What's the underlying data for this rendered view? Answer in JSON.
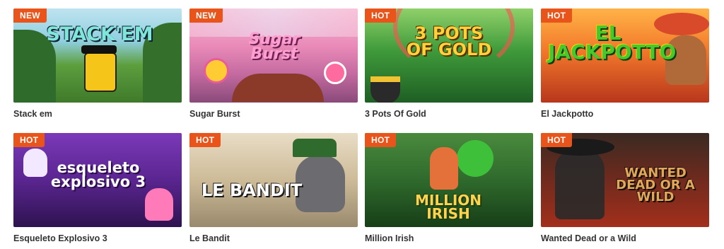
{
  "games": [
    {
      "title": "Stack em",
      "badge": "NEW",
      "logo": "STACK'EM",
      "art": "stack"
    },
    {
      "title": "Sugar Burst",
      "badge": "NEW",
      "logo": "Sugar Burst",
      "art": "sugar"
    },
    {
      "title": "3 Pots Of Gold",
      "badge": "HOT",
      "logo": "3 POTS OF GOLD",
      "art": "pots"
    },
    {
      "title": "El Jackpotto",
      "badge": "HOT",
      "logo": "EL JACKPOTTO",
      "art": "jackpotto"
    },
    {
      "title": "Esqueleto Explosivo 3",
      "badge": "HOT",
      "logo": "esqueleto explosivo 3",
      "art": "esqueleto"
    },
    {
      "title": "Le Bandit",
      "badge": "HOT",
      "logo": "LE BANDIT",
      "art": "bandit"
    },
    {
      "title": "Million Irish",
      "badge": "HOT",
      "logo": "MILLION IRISH",
      "art": "irish"
    },
    {
      "title": "Wanted Dead or a Wild",
      "badge": "HOT",
      "logo": "WANTED DEAD OR A WILD",
      "art": "wanted"
    }
  ],
  "colors": {
    "badge_bg": "#e8541a",
    "title_text": "#333333"
  }
}
